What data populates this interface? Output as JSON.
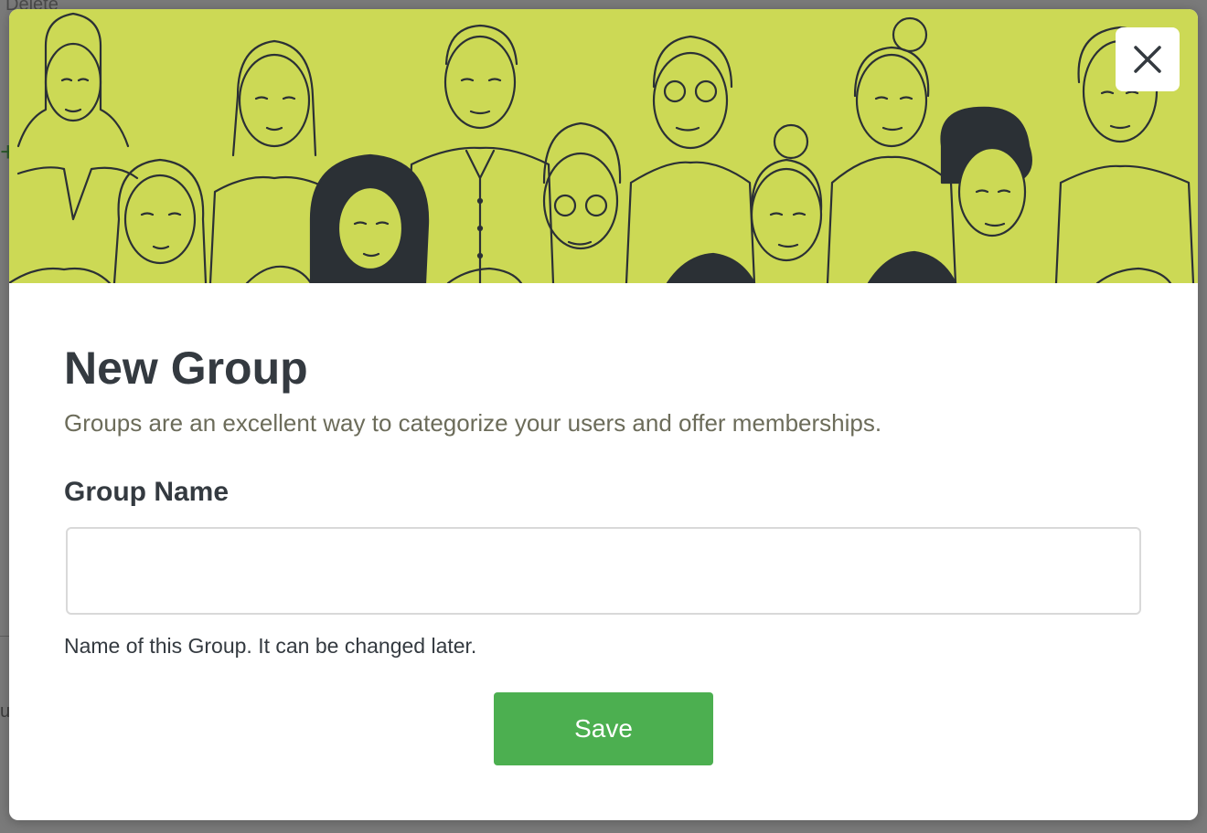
{
  "background": {
    "top_text": "Delete",
    "side_text": "u",
    "plus_glyph": "+"
  },
  "modal": {
    "banner_image": "people-illustration",
    "close_icon": "close-icon",
    "title": "New Group",
    "subtitle": "Groups are an excellent way to categorize your users and offer memberships.",
    "field": {
      "label": "Group Name",
      "value": "",
      "placeholder": "",
      "help": "Name of this Group. It can be changed later."
    },
    "save_label": "Save"
  },
  "colors": {
    "banner": "#ccd955",
    "save_button": "#4caf50",
    "title": "#343a40",
    "subtitle": "#6c6c5a"
  }
}
